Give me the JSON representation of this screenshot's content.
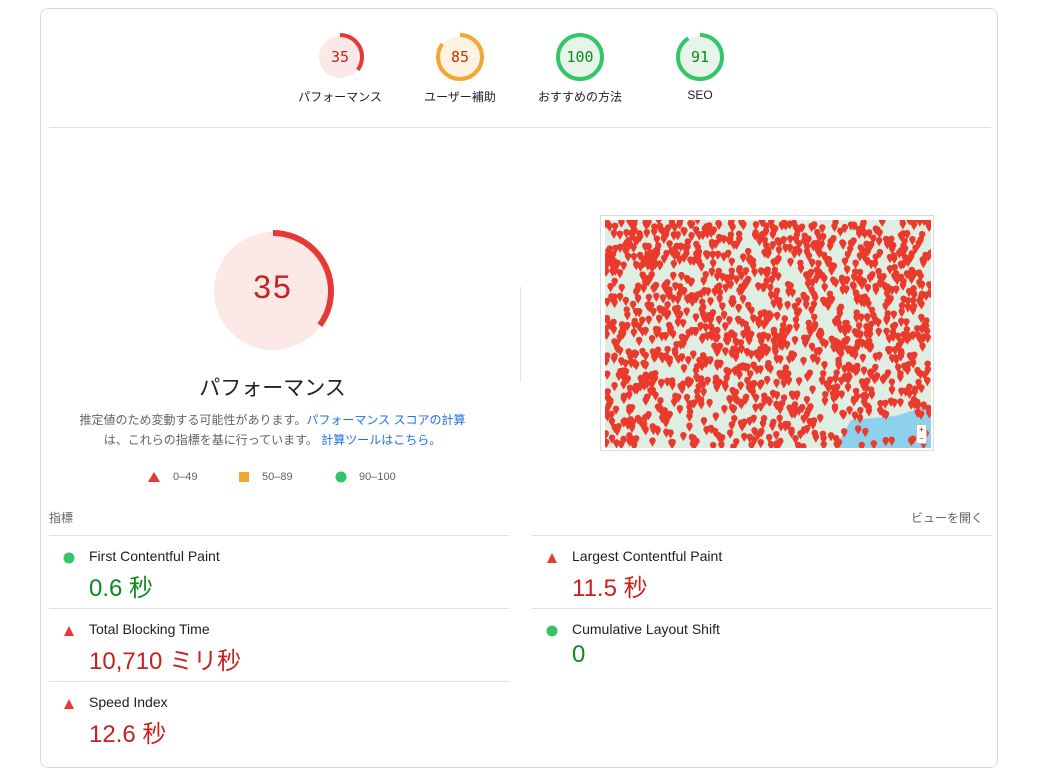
{
  "scores": [
    {
      "value": "35",
      "label": "パフォーマンス",
      "level": "fail",
      "fraction": 0.35
    },
    {
      "value": "85",
      "label": "ユーザー補助",
      "level": "average",
      "fraction": 0.85
    },
    {
      "value": "100",
      "label": "おすすめの方法",
      "level": "pass",
      "fraction": 1.0
    },
    {
      "value": "91",
      "label": "SEO",
      "level": "pass",
      "fraction": 0.91
    }
  ],
  "performance": {
    "score": "35",
    "fraction": 0.35,
    "title": "パフォーマンス",
    "desc_text1": "推定値のため変動する可能性があります。",
    "desc_link1": "パフォーマンス スコアの計算",
    "desc_text2": "は、これらの指標を基に行っています。",
    "desc_link2": "計算ツールはこちら。"
  },
  "legend": [
    {
      "range": "0–49",
      "shape": "triangle",
      "color": "#e53935"
    },
    {
      "range": "50–89",
      "shape": "square",
      "color": "#f4a632"
    },
    {
      "range": "90–100",
      "shape": "circle",
      "color": "#33c566"
    }
  ],
  "metrics_header": {
    "left": "指標",
    "right": "ビューを開く"
  },
  "metrics": [
    {
      "name": "First Contentful Paint",
      "value": "0.6 秒",
      "status": "pass"
    },
    {
      "name": "Largest Contentful Paint",
      "value": "11.5 秒",
      "status": "fail"
    },
    {
      "name": "Total Blocking Time",
      "value": "10,710 ミリ秒",
      "status": "fail"
    },
    {
      "name": "Cumulative Layout Shift",
      "value": "0",
      "status": "pass"
    },
    {
      "name": "Speed Index",
      "value": "12.6 秒",
      "status": "fail"
    }
  ],
  "map": {
    "zoom_in": "+",
    "zoom_out": "−"
  },
  "colors": {
    "fail": "#e53935",
    "fail_bg": "#fce8e6",
    "fail_text": "#c5221f",
    "average": "#f4a632",
    "average_bg": "#fef3e2",
    "average_text": "#c33300",
    "pass": "#33c566",
    "pass_bg": "#e6f4ea",
    "pass_text": "#0d8a1f"
  }
}
